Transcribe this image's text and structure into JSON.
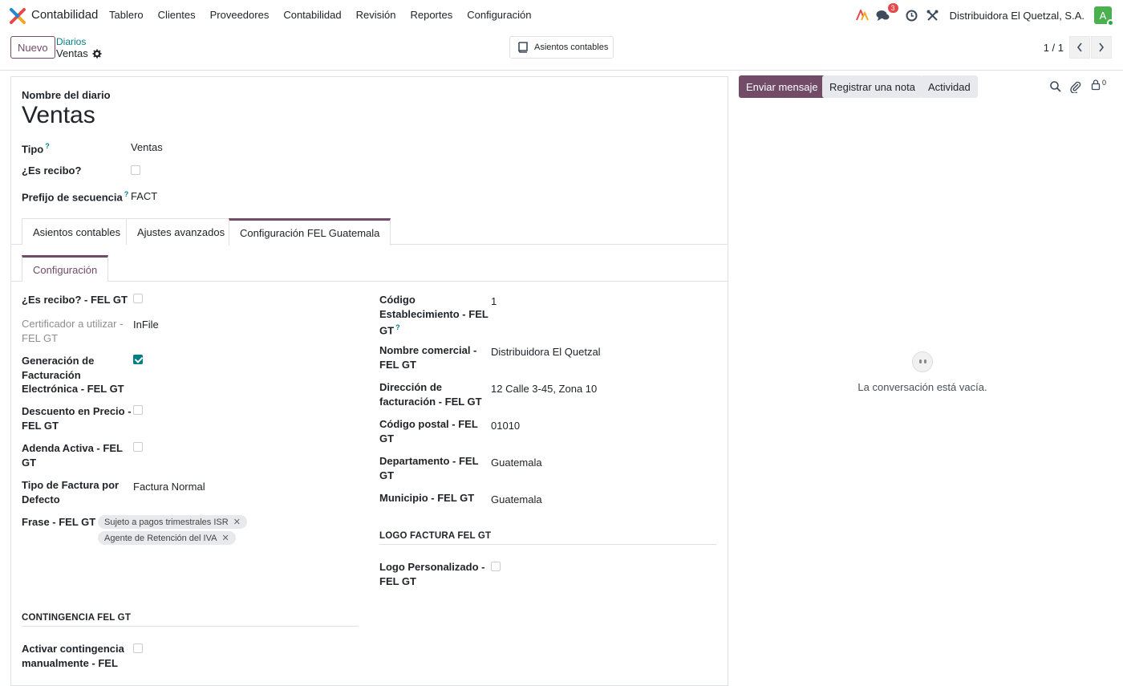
{
  "navbar": {
    "app_name": "Contabilidad",
    "menu": [
      "Tablero",
      "Clientes",
      "Proveedores",
      "Contabilidad",
      "Revisión",
      "Reportes",
      "Configuración"
    ],
    "messages_badge": "3",
    "company": "Distribuidora El Quetzal, S.A.",
    "avatar_letter": "A"
  },
  "control": {
    "new_button": "Nuevo",
    "breadcrumb_parent": "Diarios",
    "breadcrumb_current": "Ventas",
    "smart_button": "Asientos contables",
    "pager": "1 / 1"
  },
  "form": {
    "name_label": "Nombre del diario",
    "name_value": "Ventas",
    "tipo_label": "Tipo",
    "tipo_value": "Ventas",
    "es_recibo_label": "¿Es recibo?",
    "prefijo_label": "Prefijo de secuencia",
    "prefijo_value": "FACT",
    "tabs": [
      "Asientos contables",
      "Ajustes avanzados",
      "Configuración FEL Guatemala"
    ],
    "subtab": "Configuración",
    "left": {
      "es_recibo_fel_label": "¿Es recibo? - FEL GT",
      "certificador_label_1": "Certificador a utilizar -",
      "certificador_label_2": "FEL GT",
      "certificador_value": "InFile",
      "generacion_label_1": "Generación de",
      "generacion_label_2": "Facturación",
      "generacion_label_3": "Electrónica - FEL GT",
      "descuento_label_1": "Descuento en Precio -",
      "descuento_label_2": "FEL GT",
      "adenda_label_1": "Adenda Activa - FEL",
      "adenda_label_2": "GT",
      "tipo_factura_label_1": "Tipo de Factura por",
      "tipo_factura_label_2": "Defecto",
      "tipo_factura_value": "Factura Normal",
      "frase_label": "Frase - FEL GT",
      "frase_tags": [
        "Sujeto a pagos trimestrales ISR",
        "Agente de Retención del IVA"
      ],
      "contingencia_title": "CONTINGENCIA FEL GT",
      "activar_label_1": "Activar contingencia",
      "activar_label_2": "manualmente - FEL"
    },
    "right": {
      "codigo_est_label_1": "Código",
      "codigo_est_label_2": "Establecimiento - FEL",
      "codigo_est_label_3": "GT",
      "codigo_est_value": "1",
      "nombre_com_label_1": "Nombre comercial -",
      "nombre_com_label_2": "FEL GT",
      "nombre_com_value": "Distribuidora El Quetzal",
      "direccion_label_1": "Dirección de",
      "direccion_label_2": "facturación - FEL GT",
      "direccion_value": "12 Calle 3-45, Zona 10",
      "postal_label_1": "Código postal - FEL",
      "postal_label_2": "GT",
      "postal_value": "01010",
      "depto_label_1": "Departamento - FEL",
      "depto_label_2": "GT",
      "depto_value": "Guatemala",
      "municipio_label": "Municipio - FEL GT",
      "municipio_value": "Guatemala",
      "logo_title": "LOGO FACTURA FEL GT",
      "logo_label_1": "Logo Personalizado -",
      "logo_label_2": "FEL GT"
    }
  },
  "chatter": {
    "send_message": "Enviar mensaje",
    "log_note": "Registrar una nota",
    "activity": "Actividad",
    "followers_count": "0",
    "empty_text": "La conversación está vacía."
  },
  "colors": {
    "primary": "#714b67",
    "accent": "#017e84"
  }
}
